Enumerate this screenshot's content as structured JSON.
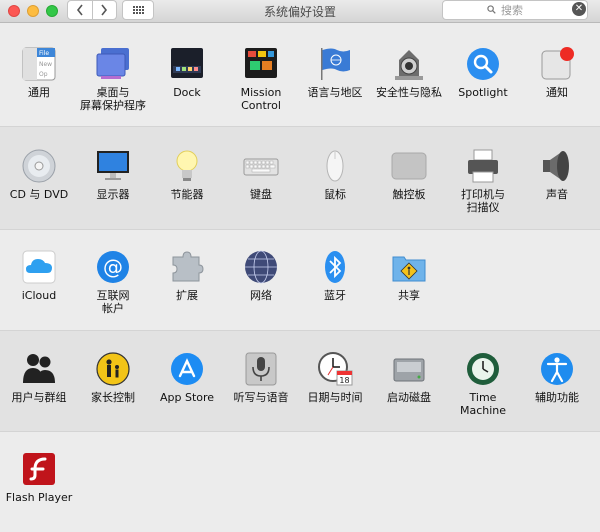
{
  "window": {
    "title": "系统偏好设置",
    "search": {
      "placeholder": "搜索"
    }
  },
  "sections": [
    {
      "items": [
        {
          "label": "通用",
          "icon": "general-icon"
        },
        {
          "label": "桌面与\n屏幕保护程序",
          "icon": "desktop-screensaver-icon"
        },
        {
          "label": "Dock",
          "icon": "dock-icon"
        },
        {
          "label": "Mission\nControl",
          "icon": "mission-control-icon"
        },
        {
          "label": "语言与地区",
          "icon": "language-region-icon"
        },
        {
          "label": "安全性与隐私",
          "icon": "security-privacy-icon"
        },
        {
          "label": "Spotlight",
          "icon": "spotlight-icon"
        },
        {
          "label": "通知",
          "icon": "notifications-icon"
        }
      ]
    },
    {
      "items": [
        {
          "label": "CD 与 DVD",
          "icon": "cd-dvd-icon"
        },
        {
          "label": "显示器",
          "icon": "displays-icon"
        },
        {
          "label": "节能器",
          "icon": "energy-saver-icon"
        },
        {
          "label": "键盘",
          "icon": "keyboard-icon"
        },
        {
          "label": "鼠标",
          "icon": "mouse-icon"
        },
        {
          "label": "触控板",
          "icon": "trackpad-icon"
        },
        {
          "label": "打印机与\n扫描仪",
          "icon": "printers-scanners-icon"
        },
        {
          "label": "声音",
          "icon": "sound-icon"
        }
      ]
    },
    {
      "items": [
        {
          "label": "iCloud",
          "icon": "icloud-icon"
        },
        {
          "label": "互联网\n帐户",
          "icon": "internet-accounts-icon"
        },
        {
          "label": "扩展",
          "icon": "extensions-icon"
        },
        {
          "label": "网络",
          "icon": "network-icon"
        },
        {
          "label": "蓝牙",
          "icon": "bluetooth-icon"
        },
        {
          "label": "共享",
          "icon": "sharing-icon"
        }
      ]
    },
    {
      "items": [
        {
          "label": "用户与群组",
          "icon": "users-groups-icon"
        },
        {
          "label": "家长控制",
          "icon": "parental-controls-icon"
        },
        {
          "label": "App Store",
          "icon": "app-store-icon"
        },
        {
          "label": "听写与语音",
          "icon": "dictation-speech-icon"
        },
        {
          "label": "日期与时间",
          "icon": "date-time-icon"
        },
        {
          "label": "启动磁盘",
          "icon": "startup-disk-icon"
        },
        {
          "label": "Time Machine",
          "icon": "time-machine-icon"
        },
        {
          "label": "辅助功能",
          "icon": "accessibility-icon"
        }
      ]
    },
    {
      "items": [
        {
          "label": "Flash Player",
          "icon": "flash-player-icon"
        }
      ]
    }
  ],
  "calendar_badge": "18"
}
